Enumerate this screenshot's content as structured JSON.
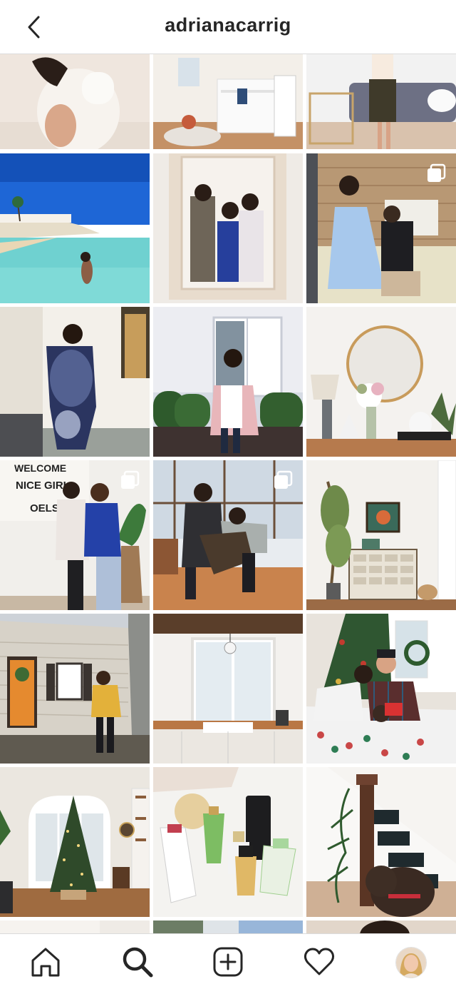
{
  "header": {
    "username": "adrianacarrig"
  },
  "icons": {
    "back": "chevron-left-icon",
    "home": "home-icon",
    "search": "search-icon",
    "create": "plus-square-icon",
    "activity": "heart-icon",
    "profile": "profile-avatar"
  },
  "colors": {
    "text": "#262626",
    "border": "#dbdbdb",
    "background": "#ffffff"
  }
}
